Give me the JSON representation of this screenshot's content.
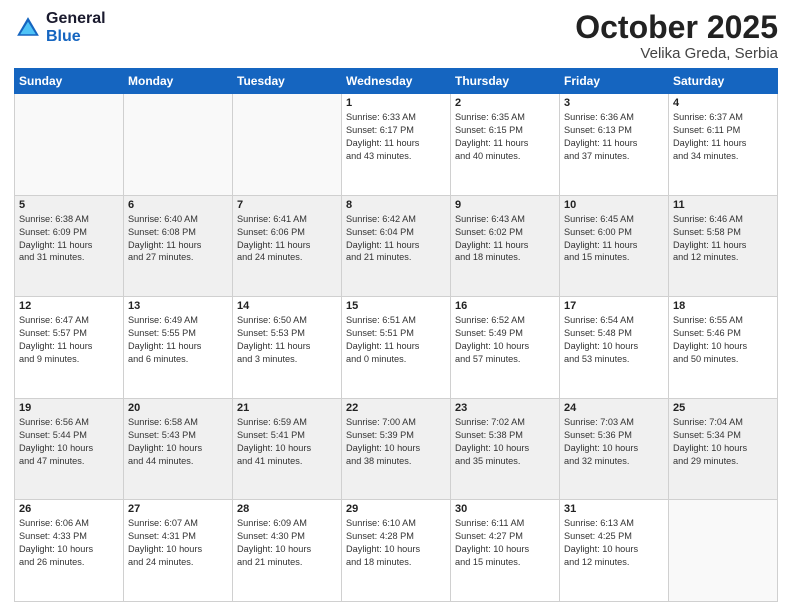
{
  "header": {
    "logo_line1": "General",
    "logo_line2": "Blue",
    "month": "October 2025",
    "location": "Velika Greda, Serbia"
  },
  "weekdays": [
    "Sunday",
    "Monday",
    "Tuesday",
    "Wednesday",
    "Thursday",
    "Friday",
    "Saturday"
  ],
  "weeks": [
    [
      {
        "day": "",
        "info": ""
      },
      {
        "day": "",
        "info": ""
      },
      {
        "day": "",
        "info": ""
      },
      {
        "day": "1",
        "info": "Sunrise: 6:33 AM\nSunset: 6:17 PM\nDaylight: 11 hours\nand 43 minutes."
      },
      {
        "day": "2",
        "info": "Sunrise: 6:35 AM\nSunset: 6:15 PM\nDaylight: 11 hours\nand 40 minutes."
      },
      {
        "day": "3",
        "info": "Sunrise: 6:36 AM\nSunset: 6:13 PM\nDaylight: 11 hours\nand 37 minutes."
      },
      {
        "day": "4",
        "info": "Sunrise: 6:37 AM\nSunset: 6:11 PM\nDaylight: 11 hours\nand 34 minutes."
      }
    ],
    [
      {
        "day": "5",
        "info": "Sunrise: 6:38 AM\nSunset: 6:09 PM\nDaylight: 11 hours\nand 31 minutes."
      },
      {
        "day": "6",
        "info": "Sunrise: 6:40 AM\nSunset: 6:08 PM\nDaylight: 11 hours\nand 27 minutes."
      },
      {
        "day": "7",
        "info": "Sunrise: 6:41 AM\nSunset: 6:06 PM\nDaylight: 11 hours\nand 24 minutes."
      },
      {
        "day": "8",
        "info": "Sunrise: 6:42 AM\nSunset: 6:04 PM\nDaylight: 11 hours\nand 21 minutes."
      },
      {
        "day": "9",
        "info": "Sunrise: 6:43 AM\nSunset: 6:02 PM\nDaylight: 11 hours\nand 18 minutes."
      },
      {
        "day": "10",
        "info": "Sunrise: 6:45 AM\nSunset: 6:00 PM\nDaylight: 11 hours\nand 15 minutes."
      },
      {
        "day": "11",
        "info": "Sunrise: 6:46 AM\nSunset: 5:58 PM\nDaylight: 11 hours\nand 12 minutes."
      }
    ],
    [
      {
        "day": "12",
        "info": "Sunrise: 6:47 AM\nSunset: 5:57 PM\nDaylight: 11 hours\nand 9 minutes."
      },
      {
        "day": "13",
        "info": "Sunrise: 6:49 AM\nSunset: 5:55 PM\nDaylight: 11 hours\nand 6 minutes."
      },
      {
        "day": "14",
        "info": "Sunrise: 6:50 AM\nSunset: 5:53 PM\nDaylight: 11 hours\nand 3 minutes."
      },
      {
        "day": "15",
        "info": "Sunrise: 6:51 AM\nSunset: 5:51 PM\nDaylight: 11 hours\nand 0 minutes."
      },
      {
        "day": "16",
        "info": "Sunrise: 6:52 AM\nSunset: 5:49 PM\nDaylight: 10 hours\nand 57 minutes."
      },
      {
        "day": "17",
        "info": "Sunrise: 6:54 AM\nSunset: 5:48 PM\nDaylight: 10 hours\nand 53 minutes."
      },
      {
        "day": "18",
        "info": "Sunrise: 6:55 AM\nSunset: 5:46 PM\nDaylight: 10 hours\nand 50 minutes."
      }
    ],
    [
      {
        "day": "19",
        "info": "Sunrise: 6:56 AM\nSunset: 5:44 PM\nDaylight: 10 hours\nand 47 minutes."
      },
      {
        "day": "20",
        "info": "Sunrise: 6:58 AM\nSunset: 5:43 PM\nDaylight: 10 hours\nand 44 minutes."
      },
      {
        "day": "21",
        "info": "Sunrise: 6:59 AM\nSunset: 5:41 PM\nDaylight: 10 hours\nand 41 minutes."
      },
      {
        "day": "22",
        "info": "Sunrise: 7:00 AM\nSunset: 5:39 PM\nDaylight: 10 hours\nand 38 minutes."
      },
      {
        "day": "23",
        "info": "Sunrise: 7:02 AM\nSunset: 5:38 PM\nDaylight: 10 hours\nand 35 minutes."
      },
      {
        "day": "24",
        "info": "Sunrise: 7:03 AM\nSunset: 5:36 PM\nDaylight: 10 hours\nand 32 minutes."
      },
      {
        "day": "25",
        "info": "Sunrise: 7:04 AM\nSunset: 5:34 PM\nDaylight: 10 hours\nand 29 minutes."
      }
    ],
    [
      {
        "day": "26",
        "info": "Sunrise: 6:06 AM\nSunset: 4:33 PM\nDaylight: 10 hours\nand 26 minutes."
      },
      {
        "day": "27",
        "info": "Sunrise: 6:07 AM\nSunset: 4:31 PM\nDaylight: 10 hours\nand 24 minutes."
      },
      {
        "day": "28",
        "info": "Sunrise: 6:09 AM\nSunset: 4:30 PM\nDaylight: 10 hours\nand 21 minutes."
      },
      {
        "day": "29",
        "info": "Sunrise: 6:10 AM\nSunset: 4:28 PM\nDaylight: 10 hours\nand 18 minutes."
      },
      {
        "day": "30",
        "info": "Sunrise: 6:11 AM\nSunset: 4:27 PM\nDaylight: 10 hours\nand 15 minutes."
      },
      {
        "day": "31",
        "info": "Sunrise: 6:13 AM\nSunset: 4:25 PM\nDaylight: 10 hours\nand 12 minutes."
      },
      {
        "day": "",
        "info": ""
      }
    ]
  ]
}
